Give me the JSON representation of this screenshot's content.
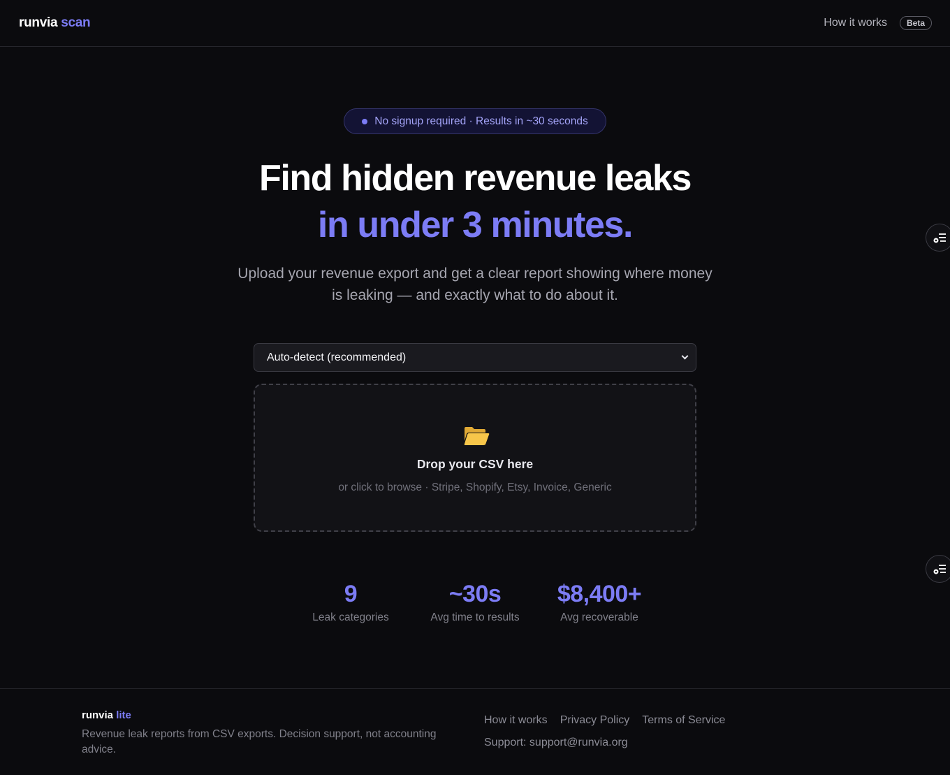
{
  "header": {
    "logo_main": "runvia",
    "logo_accent": "scan",
    "nav_how": "How it works",
    "badge": "Beta"
  },
  "hero": {
    "pill_text": "No signup required · Results in ~30 seconds",
    "title_line1": "Find hidden revenue leaks",
    "title_line2": "in under 3 minutes.",
    "subtitle": "Upload your revenue export and get a clear report showing where money is leaking — and exactly what to do about it."
  },
  "upload": {
    "select_value": "Auto-detect (recommended)",
    "drop_title": "Drop your CSV here",
    "drop_sub": "or click to browse · Stripe, Shopify, Etsy, Invoice, Generic"
  },
  "stats": [
    {
      "value": "9",
      "label": "Leak categories"
    },
    {
      "value": "~30s",
      "label": "Avg time to results"
    },
    {
      "value": "$8,400+",
      "label": "Avg recoverable"
    }
  ],
  "footer": {
    "logo_main": "runvia",
    "logo_accent": "lite",
    "description": "Revenue leak reports from CSV exports. Decision support, not accounting advice.",
    "links": [
      "How it works",
      "Privacy Policy",
      "Terms of Service"
    ],
    "support": "Support: support@runvia.org"
  },
  "icons": {
    "folder": "open-folder-icon",
    "side": "list-settings-icon",
    "chevron": "chevron-down-icon"
  },
  "colors": {
    "background": "#0b0b0e",
    "accent": "#7c7cf5"
  }
}
